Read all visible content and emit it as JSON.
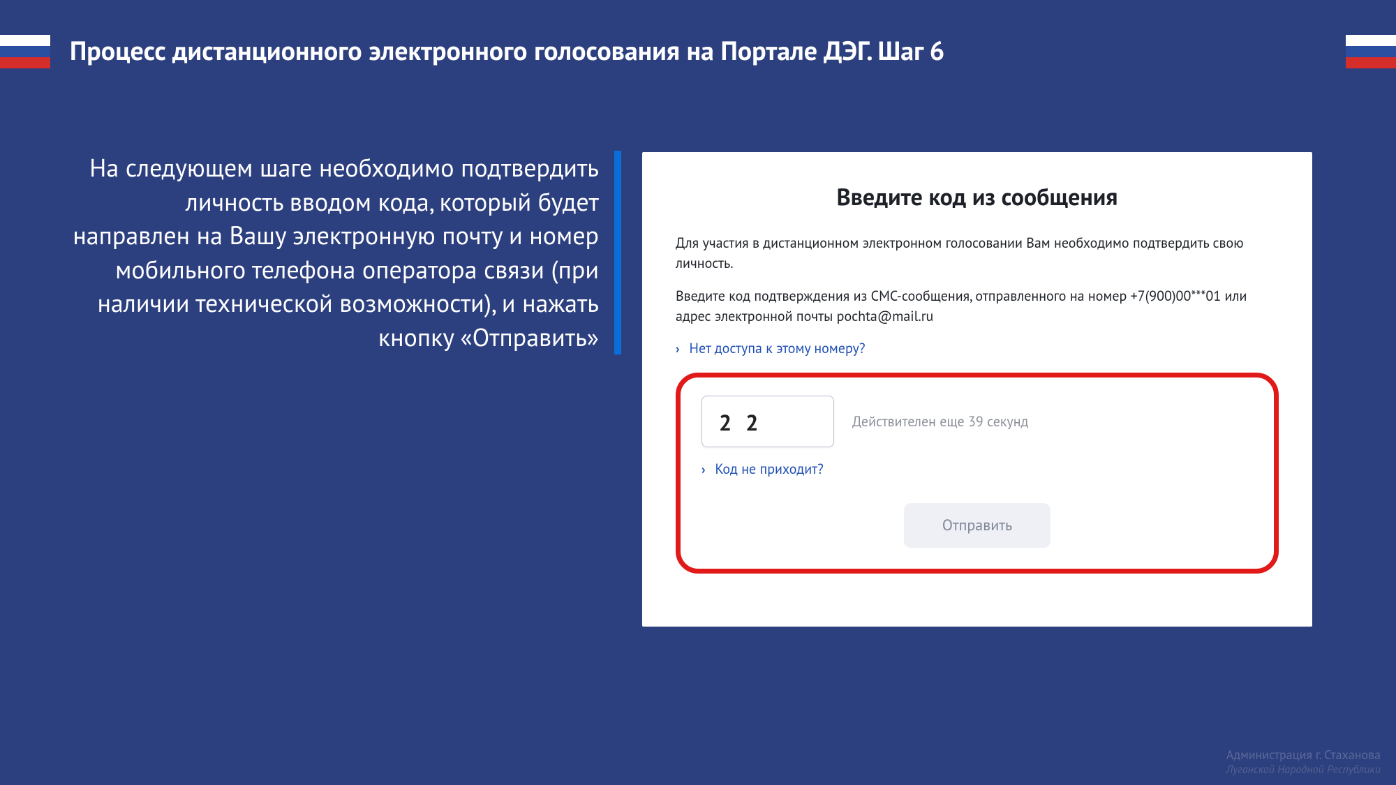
{
  "slide": {
    "title": "Процесс дистанционного электронного голосования на Портале ДЭГ. Шаг 6",
    "description": "На следующем шаге необходимо подтвердить личность вводом кода, который будет направлен на Вашу электронную почту и номер мобильного телефона оператора связи (при наличии технической возможности), и нажать кнопку «Отправить»"
  },
  "panel": {
    "title": "Введите код из сообщения",
    "paragraph1": "Для участия в дистанционном электронном голосовании Вам необходимо подтвердить свою личность.",
    "paragraph2": "Введите код подтверждения из СМС-сообщения, отправленного на номер +7(900)00***01 или адрес электронной почты pochta@mail.ru",
    "no_access_link": "Нет доступа к этому номеру?",
    "code_value": "2 2",
    "validity_text": "Действителен еще 39 секунд",
    "no_code_link": "Код не приходит?",
    "submit_label": "Отправить"
  },
  "footer": {
    "line1": "Администрация г. Стаханова",
    "line2": "Луганской Народной Республики"
  }
}
